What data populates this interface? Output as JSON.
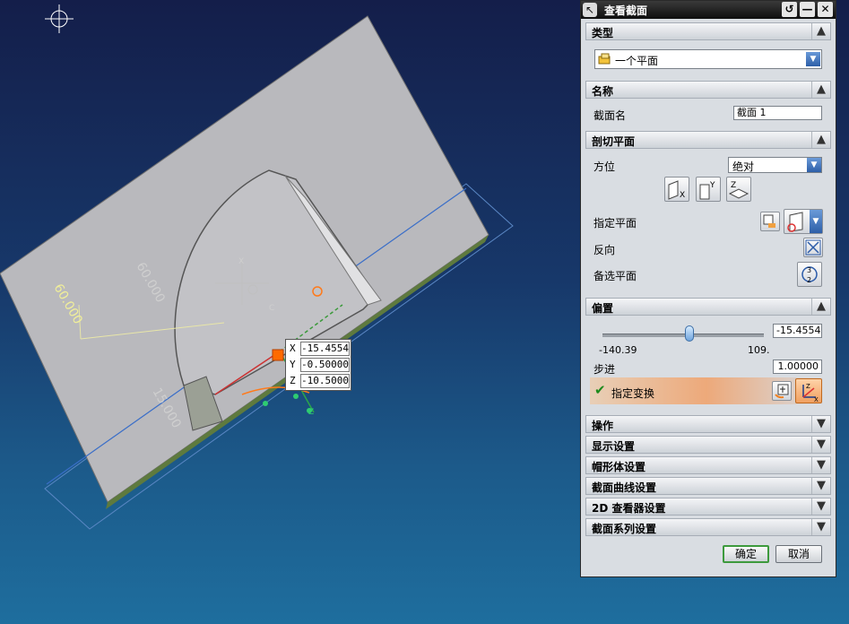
{
  "viewport": {
    "dimensions": [
      "60.000",
      "60.000",
      "15.000"
    ],
    "axis_labels": {
      "x": "X",
      "c": "C",
      "z": "Z"
    },
    "coords": {
      "x_label": "X",
      "x_value": "-15.45542",
      "y_label": "Y",
      "y_value": "-0.50000",
      "z_label": "Z",
      "z_value": "-10.50000"
    }
  },
  "dialog": {
    "title": "查看截面",
    "controls": {
      "reset": "↺",
      "minimize": "—",
      "close": "✕"
    },
    "sections": {
      "type": {
        "title": "类型",
        "value": "一个平面"
      },
      "name": {
        "title": "名称",
        "label": "截面名",
        "value": "截面 1"
      },
      "cut_plane": {
        "title": "剖切平面",
        "orientation_label": "方位",
        "orientation_value": "绝对",
        "plane_buttons": [
          "X",
          "Y",
          "Z"
        ],
        "specify_plane": "指定平面",
        "reverse": "反向",
        "alternate_plane": "备选平面"
      },
      "offset": {
        "title": "偏置",
        "value": "-15.45542",
        "min": "-140.39",
        "max": "109.",
        "slider_fraction": 0.54,
        "step_label": "步进",
        "step_value": "1.00000",
        "transform_label": "指定变换"
      },
      "collapsed": [
        "操作",
        "显示设置",
        "帽形体设置",
        "截面曲线设置",
        "2D 查看器设置",
        "截面系列设置"
      ]
    },
    "buttons": {
      "ok": "确定",
      "cancel": "取消"
    }
  }
}
